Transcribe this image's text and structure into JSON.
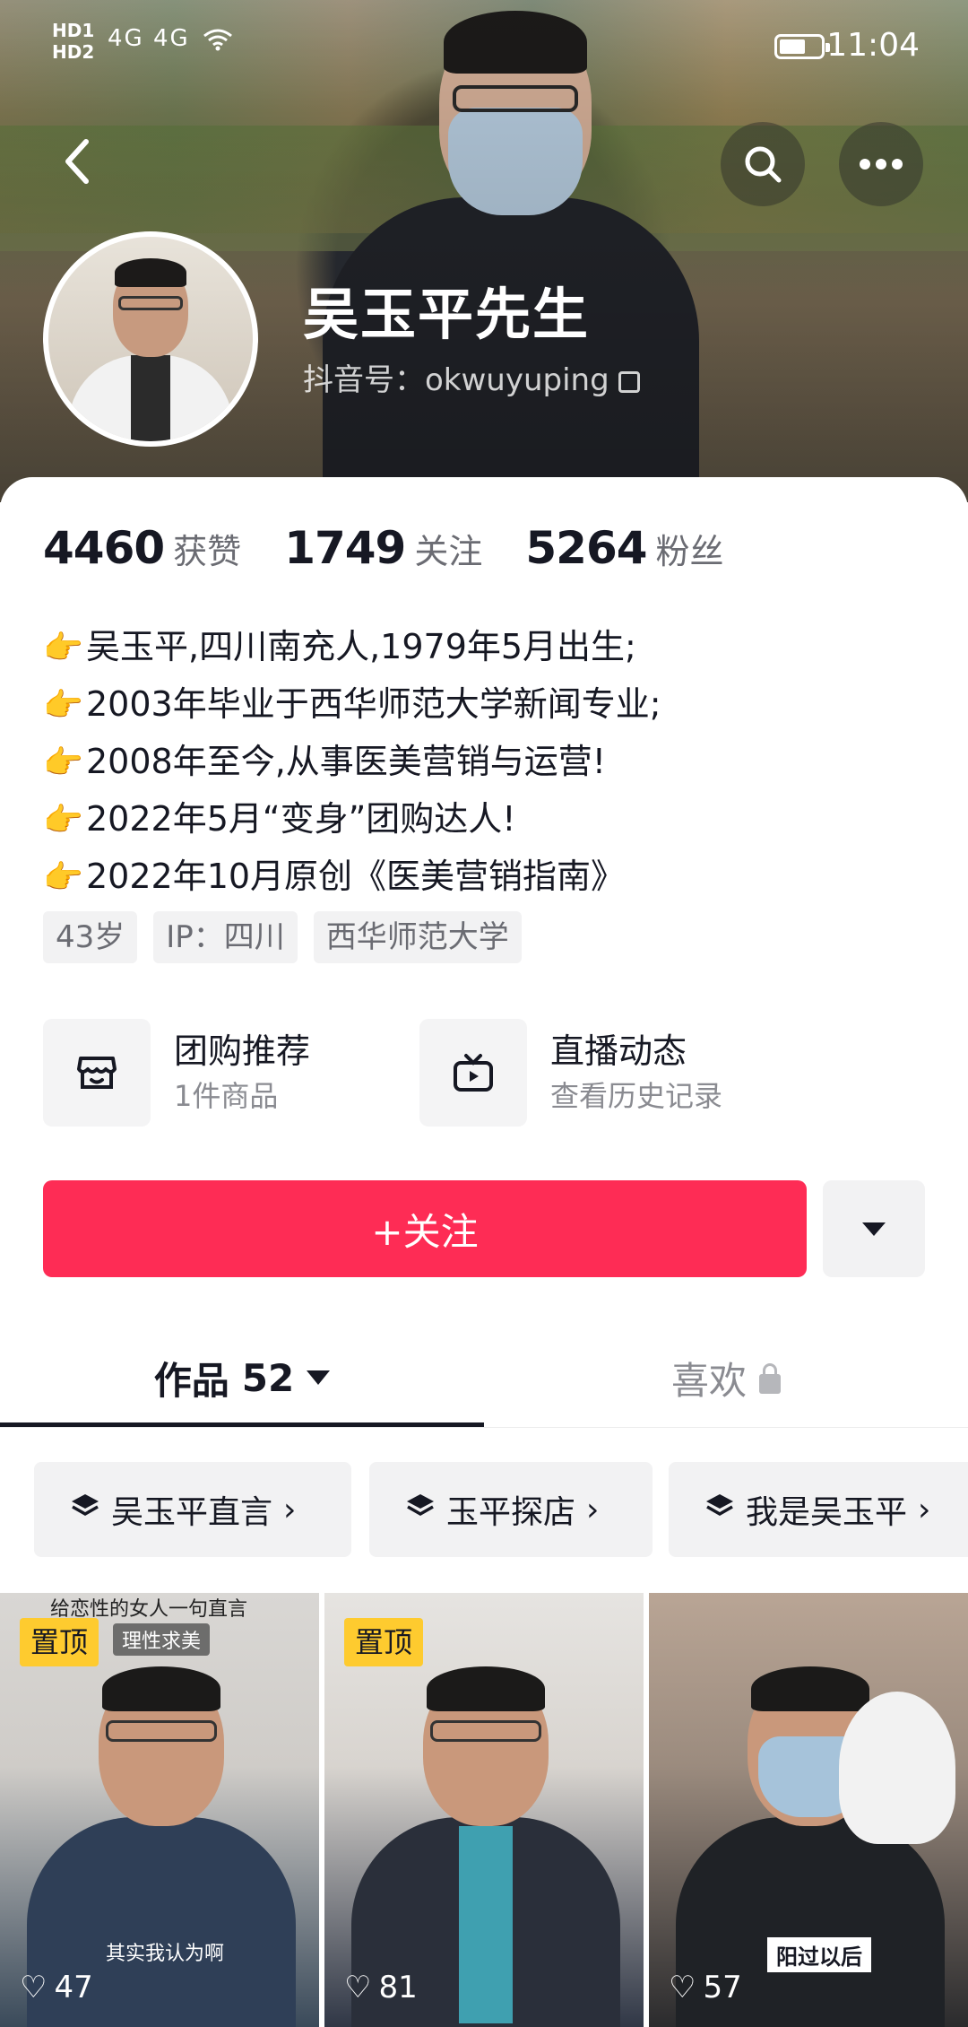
{
  "status_bar": {
    "network": "HD1\nHD2",
    "signal": "4G 4G",
    "time": "11:04"
  },
  "profile": {
    "name": "吴玉平先生",
    "douyin_id": "抖音号：okwuyuping"
  },
  "stats": [
    {
      "num": "4460",
      "label": "获赞"
    },
    {
      "num": "1749",
      "label": "关注"
    },
    {
      "num": "5264",
      "label": "粉丝"
    }
  ],
  "bio": [
    "吴玉平,四川南充人,1979年5月出生;",
    "2003年毕业于西华师范大学新闻专业;",
    "2008年至今,从事医美营销与运营!",
    "2022年5月“变身”团购达人!",
    "2022年10月原创《医美营销指南》"
  ],
  "bio_emoji": "👉",
  "tags": [
    "43岁",
    "IP：四川",
    "西华师范大学"
  ],
  "features": [
    {
      "title": "团购推荐",
      "sub": "1件商品",
      "icon": "shop-icon"
    },
    {
      "title": "直播动态",
      "sub": "查看历史记录",
      "icon": "tv-icon"
    }
  ],
  "follow_label": "+关注",
  "tabs": {
    "works_label": "作品",
    "works_count": "52",
    "likes_label": "喜欢"
  },
  "collections": [
    "吴玉平直言",
    "玉平探店",
    "我是吴玉平"
  ],
  "videos": [
    {
      "pin": "置顶",
      "likes": "47",
      "overlay_top": "给恋性的女人一句直言",
      "badge": "理性求美",
      "caption": "其实我认为啊"
    },
    {
      "pin": "置顶",
      "likes": "81"
    },
    {
      "likes": "57",
      "caption": "阳过以后"
    }
  ],
  "colors": {
    "accent": "#fe2c55",
    "pin": "#fecb2f",
    "text": "#161823",
    "muted": "#8a8b91"
  }
}
